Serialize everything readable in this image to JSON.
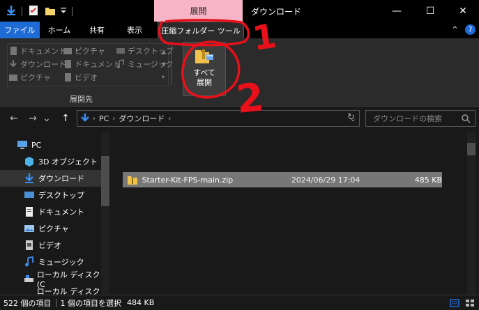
{
  "title_bar": {
    "context_tab": "展開",
    "window_title": "ダウンロード",
    "minimize": "—",
    "maximize": "☐",
    "close": "✕"
  },
  "ribbon_tabs": {
    "file": "ファイル",
    "home": "ホーム",
    "share": "共有",
    "view": "表示",
    "compressed_tools": "圧縮フォルダー ツール",
    "collapse": "⌃",
    "help": "?"
  },
  "ribbon": {
    "extract_to_items": [
      "ドキュメント",
      "ピクチャ",
      "デスクトップ",
      "ダウンロード",
      "ドキュメント",
      "ミュージック",
      "ピクチャ",
      "ビデオ"
    ],
    "group_label": "展開先",
    "extract_all_line1": "すべて",
    "extract_all_line2": "展開"
  },
  "address": {
    "back": "←",
    "forward": "→",
    "recent": "⌄",
    "up": "↑",
    "crumbs": [
      "PC",
      "ダウンロード"
    ],
    "refresh": "↻",
    "search_placeholder": "ダウンロードの検索"
  },
  "sidebar": {
    "items": [
      "PC",
      "3D オブジェクト",
      "ダウンロード",
      "デスクトップ",
      "ドキュメント",
      "ピクチャ",
      "ビデオ",
      "ミュージック",
      "ローカル ディスク (C",
      "ローカル ディスク (D"
    ]
  },
  "files": [
    {
      "name": "Starter-Kit-FPS-main.zip",
      "date": "2024/06/29 17:04",
      "size": "485 KB"
    }
  ],
  "status": {
    "count": "522 個の項目",
    "selected": "1 個の項目を選択",
    "size": "484 KB"
  },
  "annotations": [
    "1",
    "2"
  ],
  "colors": {
    "accent": "#1e6bd6",
    "context_tab": "#f6b4c6",
    "annotation": "#e8101a",
    "selection": "#777777"
  }
}
